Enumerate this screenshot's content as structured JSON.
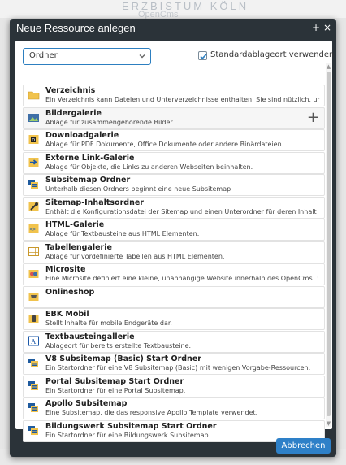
{
  "background": {
    "logo_top": "ERZBISTUM KÖLN",
    "logo_bottom": "OpenCms"
  },
  "dialog": {
    "title": "Neue Ressource anlegen",
    "controls": {
      "plus": "+",
      "close": "×"
    },
    "type_select": {
      "value": "Ordner"
    },
    "default_location": {
      "label": "Standardablageort verwenden",
      "checked": true
    },
    "cancel_label": "Abbrechen"
  },
  "items": [
    {
      "name": "Verzeichnis",
      "desc": "Ein Verzeichnis kann Dateien und Unterverzeichnisse enthalten. Sie sind nützlich, ur",
      "icon": "folder-icon"
    },
    {
      "name": "Bildergalerie",
      "desc": "Ablage für zusammengehörende Bilder.",
      "icon": "image-gallery-icon",
      "hover_plus": "+"
    },
    {
      "name": "Downloadgalerie",
      "desc": "Ablage für PDF Dokumente, Office Dokumente oder andere Binärdateien.",
      "icon": "download-gallery-icon"
    },
    {
      "name": "Externe Link-Galerie",
      "desc": "Ablage für Objekte, die Links zu anderen Webseiten beinhalten.",
      "icon": "link-gallery-icon"
    },
    {
      "name": "Subsitemap Ordner",
      "desc": "Unterhalb diesen Ordners beginnt eine neue Subsitemap",
      "icon": "subsitemap-icon"
    },
    {
      "name": "Sitemap-Inhaltsordner",
      "desc": "Enthält die Konfigurationsdatei der Sitemap und einen Unterordner für deren Inhalt",
      "icon": "sitemap-content-icon"
    },
    {
      "name": "HTML-Galerie",
      "desc": "Ablage für Textbausteine aus HTML Elementen.",
      "icon": "html-gallery-icon"
    },
    {
      "name": "Tabellengalerie",
      "desc": "Ablage für vordefinierte Tabellen aus HTML Elementen.",
      "icon": "table-gallery-icon"
    },
    {
      "name": "Microsite",
      "desc": "Eine Microsite definiert eine kleine, unabhängige Website innerhalb des OpenCms. !",
      "icon": "microsite-icon"
    },
    {
      "name": "Onlineshop",
      "desc": "",
      "icon": "onlineshop-icon"
    },
    {
      "name": "EBK Mobil",
      "desc": "Stellt Inhalte für mobile Endgeräte dar.",
      "icon": "mobile-icon"
    },
    {
      "name": "Textbausteingallerie",
      "desc": "Ablageort für bereits erstellte Textbausteine.",
      "icon": "text-gallery-icon"
    },
    {
      "name": "V8 Subsitemap (Basic) Start Ordner",
      "desc": "Ein Startordner für eine V8 Subsitemap (Basic) mit wenigen Vorgabe-Ressourcen.",
      "icon": "v8-subsitemap-icon"
    },
    {
      "name": "Portal Subsitemap Start Ordner",
      "desc": "Ein Startordner für eine Portal Subsitemap.",
      "icon": "portal-subsitemap-icon"
    },
    {
      "name": "Apollo Subsitemap",
      "desc": "Eine Subsitemap, die das responsive Apollo Template verwendet.",
      "icon": "apollo-subsitemap-icon"
    },
    {
      "name": "Bildungswerk Subsitemap Start Ordner",
      "desc": "Ein Startordner für eine Bildungswerk Subsitemap.",
      "icon": "bildungswerk-subsitemap-icon"
    }
  ]
}
